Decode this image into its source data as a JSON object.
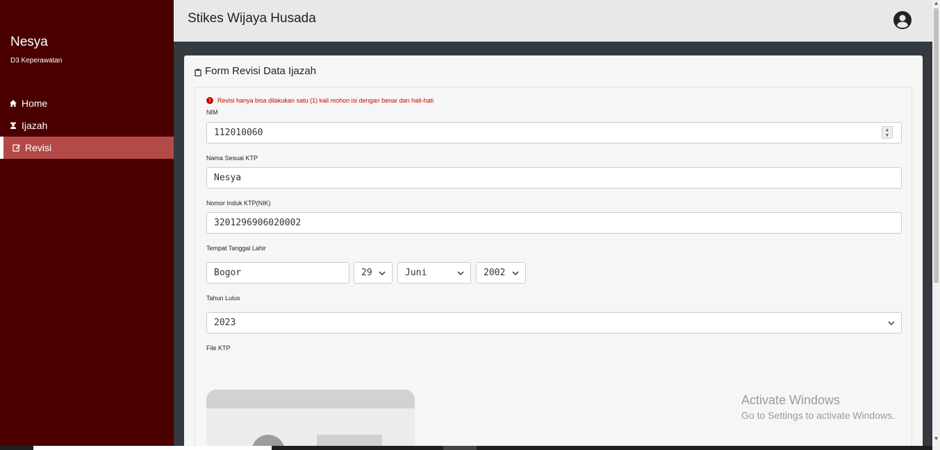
{
  "sidebar": {
    "user_name": "Nesya",
    "user_prodi": "D3 Keperawatan",
    "items": [
      {
        "label": "Home",
        "icon": "home-icon"
      },
      {
        "label": "Ijazah",
        "icon": "graduate-icon"
      },
      {
        "label": "Revisi",
        "icon": "edit-icon",
        "active": true
      }
    ]
  },
  "header": {
    "title": "Stikes Wijaya Husada",
    "avatar_icon": "user-circle-icon"
  },
  "form": {
    "title": "Form Revisi Data Ijazah",
    "alert": "Revisi hanya bisa dilakukan satu (1) kali mohon isi dengan benar dan hati-hati",
    "nim": {
      "label": "NIM",
      "value": "112010060"
    },
    "nama": {
      "label": "Nama Sesuai KTP",
      "value": "Nesya"
    },
    "nik": {
      "label": "Nomor Induk KTP(NIK)",
      "value": "3201296906020002"
    },
    "ttl": {
      "label": "Tempat Tanggal Lahir",
      "tempat": "Bogor",
      "tanggal": "29",
      "bulan": "Juni",
      "tahun": "2002"
    },
    "tahun_lulus": {
      "label": "Tahun Lulus",
      "value": "2023"
    },
    "file_ktp": {
      "label": "File KTP"
    }
  },
  "watermark": {
    "title": "Activate Windows",
    "subtitle": "Go to Settings to activate Windows."
  },
  "colors": {
    "sidebar_bg": "#4b0000",
    "active_item": "#b44a48",
    "alert": "#d00000"
  }
}
